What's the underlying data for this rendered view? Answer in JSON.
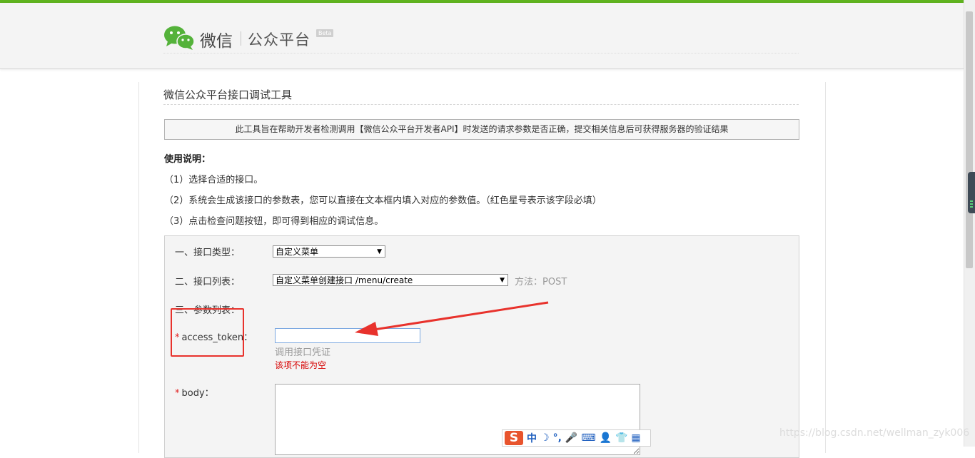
{
  "header": {
    "logo_wechat": "微信",
    "logo_platform": "公众平台",
    "beta": "Beta"
  },
  "page": {
    "title": "微信公众平台接口调试工具",
    "notice": "此工具旨在帮助开发者检测调用【微信公众平台开发者API】时发送的请求参数是否正确，提交相关信息后可获得服务器的验证结果",
    "usage_title": "使用说明：",
    "usage_items": [
      "（1）选择合适的接口。",
      "（2）系统会生成该接口的参数表，您可以直接在文本框内填入对应的参数值。（红色星号表示该字段必填）",
      "（3）点击检查问题按钮，即可得到相应的调试信息。"
    ]
  },
  "form": {
    "api_type_label": "一、接口类型：",
    "api_type_value": "自定义菜单",
    "api_list_label": "二、接口列表：",
    "api_list_value": "自定义菜单创建接口 /menu/create",
    "method_text": "方法：POST",
    "params_label": "三、参数列表：",
    "required_mark": "*",
    "access_token_label": "access_token：",
    "access_token_value": "",
    "access_token_hint": "调用接口凭证",
    "access_token_error": "该项不能为空",
    "body_label": "body："
  },
  "ime": {
    "logo": "S",
    "items": [
      "中",
      "☽",
      "°,",
      "🎤",
      "⌨",
      "👤",
      "👕",
      "▦"
    ]
  },
  "watermark": "https://blog.csdn.net/wellman_zyk006",
  "colors": {
    "top_bar": "#5fb31f",
    "required": "#e02020",
    "annotation": "#e8322c"
  }
}
